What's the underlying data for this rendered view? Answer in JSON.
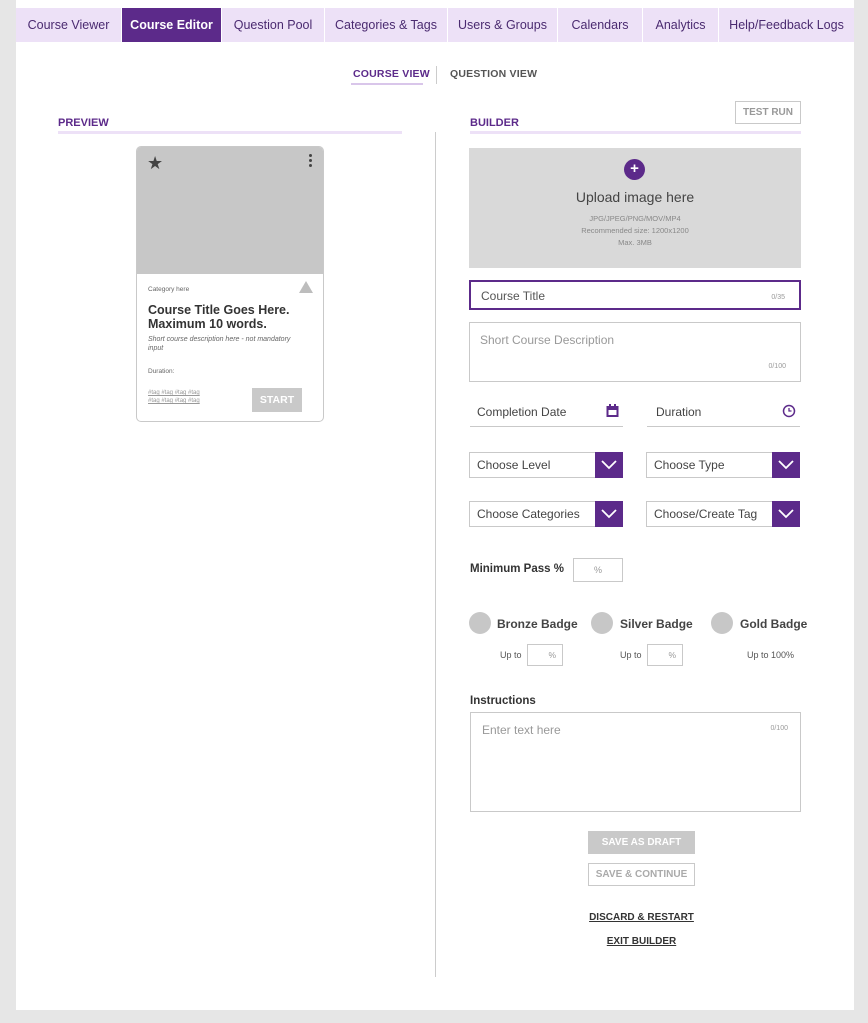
{
  "nav": {
    "tabs": [
      {
        "label": "Course Viewer"
      },
      {
        "label": "Course Editor"
      },
      {
        "label": "Question Pool"
      },
      {
        "label": "Categories & Tags"
      },
      {
        "label": "Users & Groups"
      },
      {
        "label": "Calendars"
      },
      {
        "label": "Analytics"
      },
      {
        "label": "Help/Feedback Logs"
      }
    ],
    "active_index": 1
  },
  "view_toggle": {
    "course_view": "COURSE VIEW",
    "question_view": "QUESTION VIEW"
  },
  "preview": {
    "title": "PREVIEW",
    "card": {
      "category": "Category here",
      "title": "Course Title Goes Here. Maximum 10 words.",
      "description": "Short course description here - not mandatory input",
      "duration": "Duration:",
      "tags_line1": "#tag  #tag  #tag  #tag",
      "tags_line2": "#tag  #tag  #tag  #tag",
      "start": "START"
    }
  },
  "builder": {
    "title": "BUILDER",
    "test_run": "TEST RUN",
    "upload": {
      "title": "Upload image here",
      "formats": "JPG/JPEG/PNG/MOV/MP4",
      "size": "Recommended size: 1200x1200",
      "max": "Max. 3MB"
    },
    "course_title": {
      "placeholder": "Course Title",
      "count": "0/35"
    },
    "description": {
      "placeholder": "Short Course Description",
      "count": "0/100"
    },
    "completion_date": "Completion Date",
    "duration": "Duration",
    "level": "Choose Level",
    "type": "Choose Type",
    "categories": "Choose Categories",
    "tag": "Choose/Create Tag",
    "min_pass_label": "Minimum Pass %",
    "min_pass_value": "%",
    "badges": [
      {
        "label": "Bronze Badge",
        "upto": "Up to",
        "value": "%"
      },
      {
        "label": "Silver Badge",
        "upto": "Up to",
        "value": "%"
      },
      {
        "label": "Gold Badge",
        "upto": "Up to 100%"
      }
    ],
    "instructions_label": "Instructions",
    "instructions": {
      "placeholder": "Enter text here",
      "count": "0/100"
    },
    "save_draft": "SAVE AS DRAFT",
    "save_continue": "SAVE & CONTINUE",
    "discard": "DISCARD & RESTART",
    "exit": "EXIT BUILDER"
  },
  "colors": {
    "accent": "#5c2a8a",
    "accent_light": "#ede1f7"
  }
}
